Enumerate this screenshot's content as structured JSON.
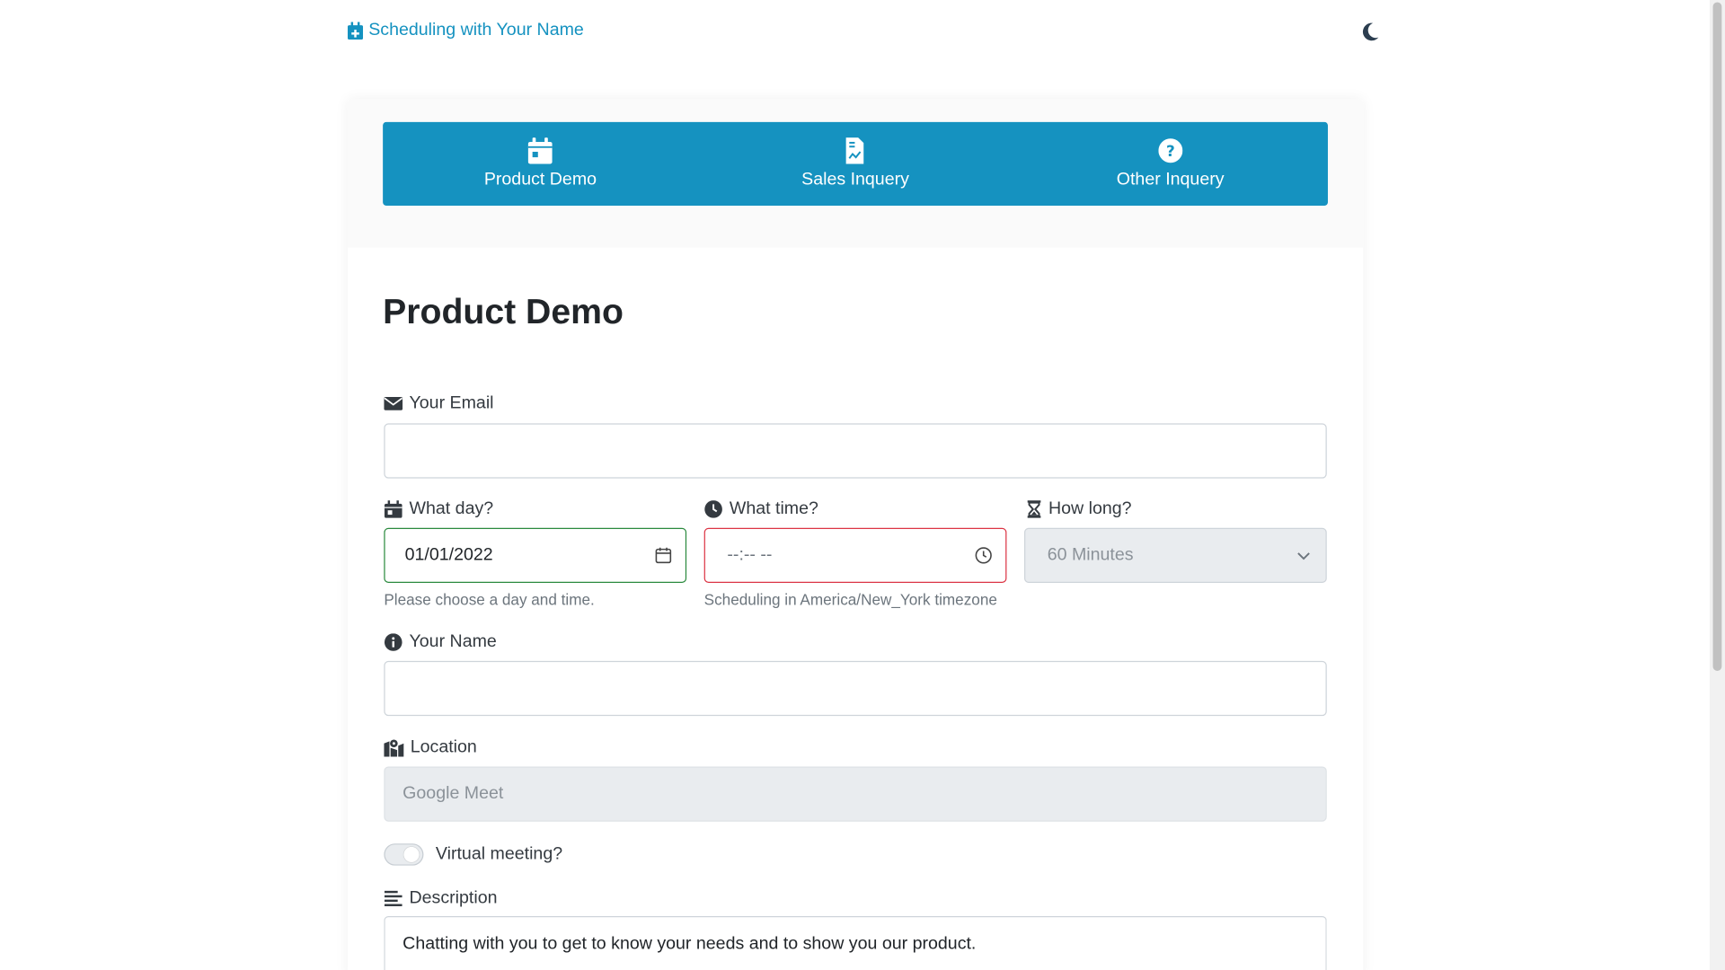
{
  "brand": {
    "label": "Scheduling with Your Name",
    "icon": "calendar-plus-icon"
  },
  "theme_toggle": {
    "icon": "moon-icon"
  },
  "colors": {
    "primary": "#1592c0",
    "valid": "#2b8a3e",
    "invalid": "#dc3545"
  },
  "tabs": [
    {
      "label": "Product Demo",
      "icon": "calendar-icon"
    },
    {
      "label": "Sales Inquery",
      "icon": "file-chart-icon"
    },
    {
      "label": "Other Inquery",
      "icon": "question-circle-icon"
    }
  ],
  "form": {
    "title": "Product Demo",
    "email": {
      "label": "Your Email",
      "value": ""
    },
    "day": {
      "label": "What day?",
      "value": "01/01/2022",
      "help": "Please choose a day and time."
    },
    "time": {
      "label": "What time?",
      "value": "--:-- --",
      "help": "Scheduling in America/New_York timezone"
    },
    "duration": {
      "label": "How long?",
      "value": "60 Minutes"
    },
    "name": {
      "label": "Your Name",
      "value": ""
    },
    "location": {
      "label": "Location",
      "value": "Google Meet"
    },
    "virtual": {
      "label": "Virtual meeting?",
      "checked": false
    },
    "description": {
      "label": "Description",
      "value": "Chatting with you to get to know your needs and to show you our product."
    }
  }
}
